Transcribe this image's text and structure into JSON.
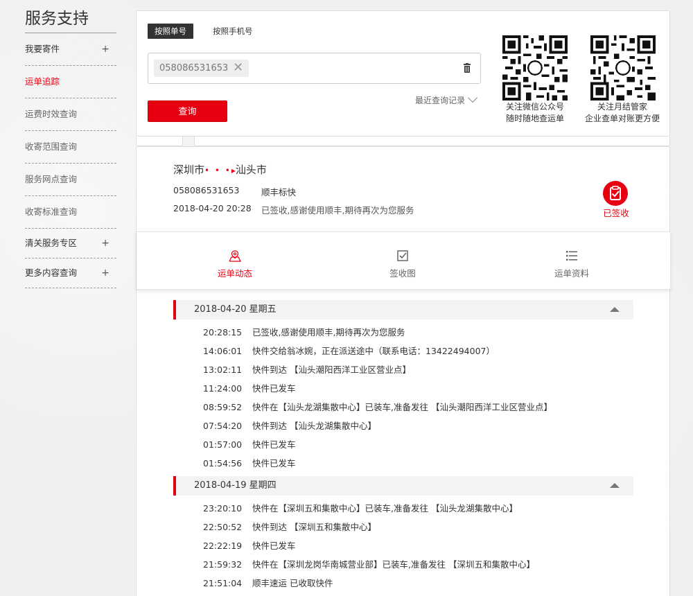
{
  "sidebar": {
    "title": "服务支持",
    "items": [
      {
        "label": "我要寄件",
        "plus": "+"
      },
      {
        "label": "运单追踪"
      },
      {
        "label": "运费时效查询"
      },
      {
        "label": "收寄范围查询"
      },
      {
        "label": "服务网点查询"
      },
      {
        "label": "收寄标准查询"
      },
      {
        "label": "清关服务专区",
        "plus": "+"
      },
      {
        "label": "更多内容查询",
        "plus": "+"
      }
    ]
  },
  "search": {
    "tab_order": "按照单号",
    "tab_phone": "按照手机号",
    "chip_value": "058086531653",
    "chip_remove": "✕",
    "recent_label": "最近查询记录",
    "query_button": "查询",
    "qr_wechat_caption_1": "关注微信公众号",
    "qr_wechat_caption_2": "随时随地查运单",
    "qr_monthly_caption_1": "关注月结管家",
    "qr_monthly_caption_2": "企业查单对账更方便"
  },
  "result": {
    "origin": "深圳市",
    "route_dots": "• • •",
    "arrow": "▸",
    "destination": "汕头市",
    "waybill_no": "058086531653",
    "service": "顺丰标快",
    "sign_time": "2018-04-20 20:28",
    "sign_message": "已签收,感谢使用顺丰,期待再次为您服务",
    "signed_label": "已签收",
    "accent_color": "#e60012"
  },
  "detail_tabs": [
    {
      "label": "运单动态",
      "icon": "map-pin-icon"
    },
    {
      "label": "签收图",
      "icon": "signature-image-icon"
    },
    {
      "label": "运单资料",
      "icon": "list-icon"
    }
  ],
  "days": [
    {
      "title": "2018-04-20 星期五",
      "events": [
        {
          "time": "20:28:15",
          "desc": "已签收,感谢使用顺丰,期待再次为您服务"
        },
        {
          "time": "14:06:01",
          "desc": "快件交给翁冰婉，正在派送途中（联系电话：13422494007）"
        },
        {
          "time": "13:02:11",
          "desc": "快件到达 【汕头潮阳西洋工业区营业点】"
        },
        {
          "time": "11:24:00",
          "desc": "快件已发车"
        },
        {
          "time": "08:59:52",
          "desc": "快件在【汕头龙湖集散中心】已装车,准备发往 【汕头潮阳西洋工业区营业点】"
        },
        {
          "time": "07:54:20",
          "desc": "快件到达 【汕头龙湖集散中心】"
        },
        {
          "time": "01:57:00",
          "desc": "快件已发车"
        },
        {
          "time": "01:54:56",
          "desc": "快件已发车"
        }
      ]
    },
    {
      "title": "2018-04-19 星期四",
      "events": [
        {
          "time": "23:20:10",
          "desc": "快件在【深圳五和集散中心】已装车,准备发往 【汕头龙湖集散中心】"
        },
        {
          "time": "22:50:52",
          "desc": "快件到达 【深圳五和集散中心】"
        },
        {
          "time": "22:22:19",
          "desc": "快件已发车"
        },
        {
          "time": "21:59:32",
          "desc": "快件在【深圳龙岗华南城营业部】已装车,准备发往 【深圳五和集散中心】"
        },
        {
          "time": "21:51:04",
          "desc": "顺丰速运 已收取快件"
        }
      ]
    }
  ]
}
